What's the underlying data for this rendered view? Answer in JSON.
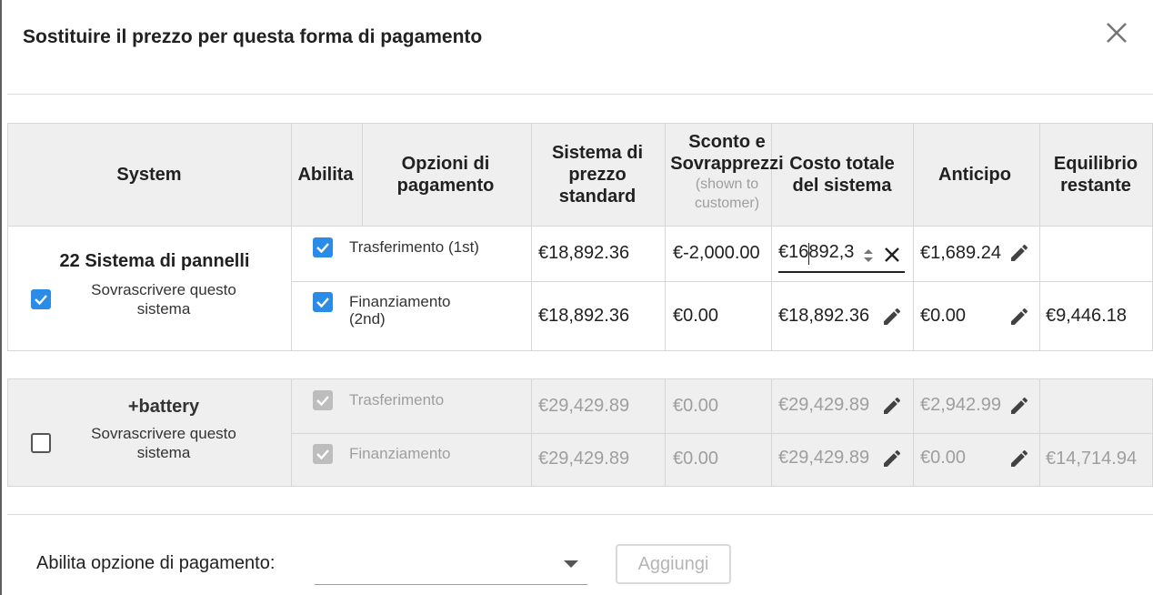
{
  "dialog": {
    "title": "Sostituire il prezzo per questa forma di pagamento"
  },
  "table": {
    "headers": {
      "system": "System",
      "enable": "Abilita",
      "payment_options": "Opzioni di pagamento",
      "standard_price": "Sistema di prezzo standard",
      "discount": "Sconto e Sovrapprezzi",
      "discount_note": "(shown to customer)",
      "total_cost": "Costo totale del sistema",
      "deposit": "Anticipo",
      "balance": "Equilibrio restante"
    },
    "systems": [
      {
        "name": "22 Sistema di pannelli",
        "override_label": "Sovrascrivere questo sistema",
        "override_checked": true,
        "rows": [
          {
            "option": "Trasferimento (1st)",
            "enabled": true,
            "standard": "€18,892.36",
            "discount": "€-2,000.00",
            "total": "€16892,3",
            "deposit": "€1,689.24",
            "balance": ""
          },
          {
            "option": "Finanziamento (2nd)",
            "enabled": true,
            "standard": "€18,892.36",
            "discount": "€0.00",
            "total": "€18,892.36",
            "deposit": "€0.00",
            "balance": "€9,446.18"
          }
        ]
      },
      {
        "name": "+battery",
        "override_label": "Sovrascrivere questo sistema",
        "override_checked": false,
        "rows": [
          {
            "option": "Trasferimento",
            "enabled": true,
            "standard": "€29,429.89",
            "discount": "€0.00",
            "total": "€29,429.89",
            "deposit": "€2,942.99",
            "balance": ""
          },
          {
            "option": "Finanziamento",
            "enabled": true,
            "standard": "€29,429.89",
            "discount": "€0.00",
            "total": "€29,429.89",
            "deposit": "€0.00",
            "balance": "€14,714.94"
          }
        ]
      }
    ]
  },
  "footer": {
    "enable_label": "Abilita opzione di pagamento:",
    "select_value": "",
    "add_button": "Aggiungi"
  },
  "icons": {
    "close": "close-icon",
    "edit": "pencil-icon",
    "check": "check-icon",
    "clear": "clear-icon",
    "spinner": "spinner-icon",
    "dropdown": "dropdown-arrow-icon"
  },
  "colors": {
    "checkbox_on": "#2a8ce6",
    "header_bg": "#efefef",
    "disabled_text": "#9e9e9e"
  }
}
